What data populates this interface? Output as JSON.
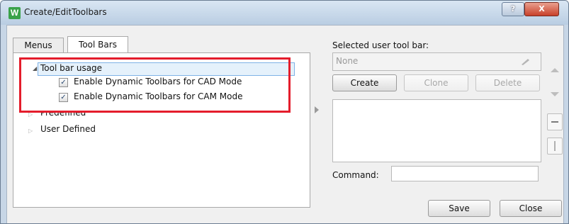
{
  "window": {
    "title": "Create/EditToolbars",
    "app_icon_letter": "W",
    "help_glyph": "?",
    "close_glyph": "X"
  },
  "tabs": [
    {
      "label": "Menus",
      "selected": false
    },
    {
      "label": "Tool Bars",
      "selected": true
    }
  ],
  "tree": {
    "tool_bar_usage": "Tool bar usage",
    "check_cad": "Enable Dynamic Toolbars for CAD Mode",
    "check_cam": "Enable Dynamic Toolbars for CAM Mode",
    "predefined": "Predefined",
    "user_defined": "User Defined",
    "check_cad_checked": true,
    "check_cam_checked": true
  },
  "right": {
    "selected_label": "Selected user tool bar:",
    "selected_value": "None",
    "create": "Create",
    "clone": "Clone",
    "delete": "Delete",
    "command_label": "Command:",
    "command_value": ""
  },
  "footer": {
    "save": "Save",
    "close": "Close"
  },
  "colors": {
    "highlight": "#e41d2c",
    "title_bar": "#c7d6e6",
    "close_button": "#c7402a"
  }
}
